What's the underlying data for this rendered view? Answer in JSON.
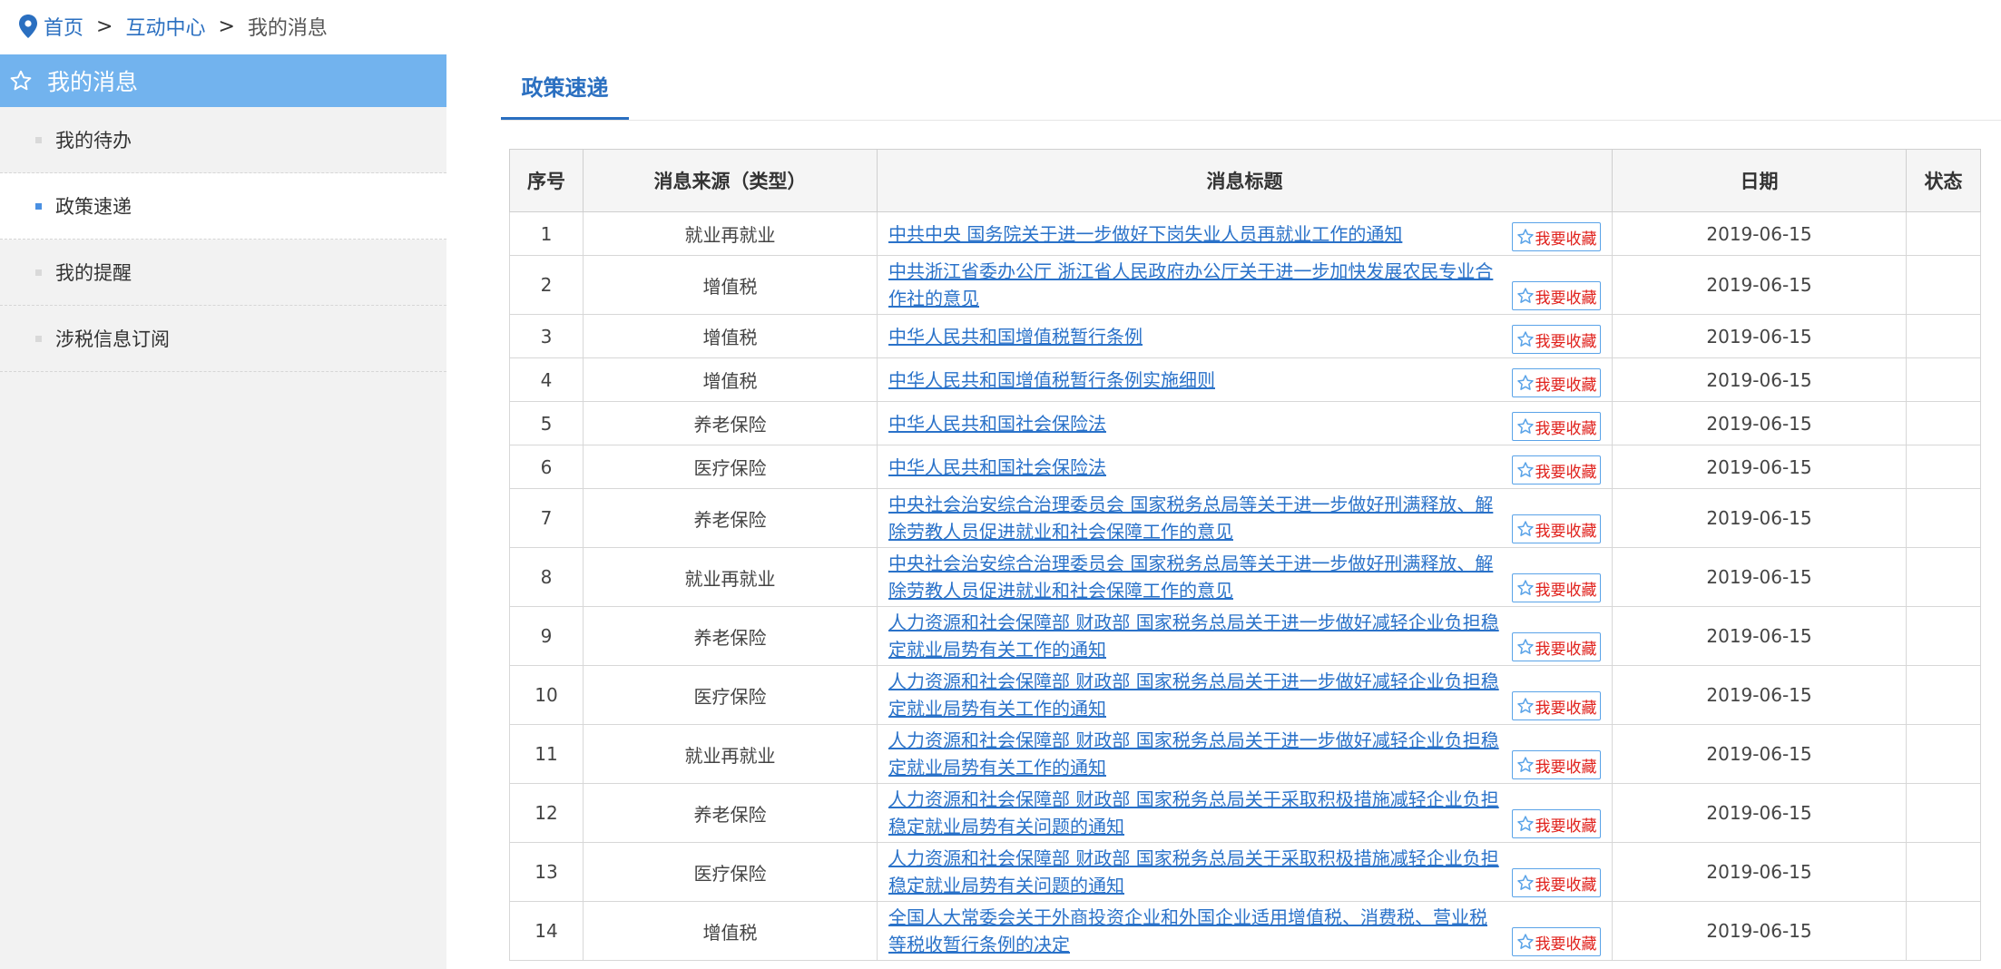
{
  "breadcrumb": {
    "home": "首页",
    "sep1": ">",
    "center": "互动中心",
    "sep2": ">",
    "current": "我的消息"
  },
  "sidebar": {
    "title": "我的消息",
    "items": [
      {
        "label": "我的待办",
        "active": false
      },
      {
        "label": "政策速递",
        "active": true
      },
      {
        "label": "我的提醒",
        "active": false
      },
      {
        "label": "涉税信息订阅",
        "active": false
      }
    ]
  },
  "tab": {
    "label": "政策速递"
  },
  "table": {
    "headers": {
      "index": "序号",
      "source": "消息来源（类型）",
      "title": "消息标题",
      "date": "日期",
      "status": "状态"
    },
    "favorite_label": "我要收藏",
    "rows": [
      {
        "index": "1",
        "source": "就业再就业",
        "title": "中共中央 国务院关于进一步做好下岗失业人员再就业工作的通知",
        "date": "2019-06-15",
        "status": ""
      },
      {
        "index": "2",
        "source": "增值税",
        "title": "中共浙江省委办公厅 浙江省人民政府办公厅关于进一步加快发展农民专业合作社的意见",
        "date": "2019-06-15",
        "status": ""
      },
      {
        "index": "3",
        "source": "增值税",
        "title": "中华人民共和国增值税暂行条例",
        "date": "2019-06-15",
        "status": ""
      },
      {
        "index": "4",
        "source": "增值税",
        "title": "中华人民共和国增值税暂行条例实施细则",
        "date": "2019-06-15",
        "status": ""
      },
      {
        "index": "5",
        "source": "养老保险",
        "title": "中华人民共和国社会保险法",
        "date": "2019-06-15",
        "status": ""
      },
      {
        "index": "6",
        "source": "医疗保险",
        "title": "中华人民共和国社会保险法",
        "date": "2019-06-15",
        "status": ""
      },
      {
        "index": "7",
        "source": "养老保险",
        "title": "中央社会治安综合治理委员会 国家税务总局等关于进一步做好刑满释放、解除劳教人员促进就业和社会保障工作的意见",
        "date": "2019-06-15",
        "status": ""
      },
      {
        "index": "8",
        "source": "就业再就业",
        "title": "中央社会治安综合治理委员会 国家税务总局等关于进一步做好刑满释放、解除劳教人员促进就业和社会保障工作的意见",
        "date": "2019-06-15",
        "status": "",
        "hover": true
      },
      {
        "index": "9",
        "source": "养老保险",
        "title": "人力资源和社会保障部 财政部 国家税务总局关于进一步做好减轻企业负担稳定就业局势有关工作的通知",
        "date": "2019-06-15",
        "status": ""
      },
      {
        "index": "10",
        "source": "医疗保险",
        "title": "人力资源和社会保障部 财政部 国家税务总局关于进一步做好减轻企业负担稳定就业局势有关工作的通知",
        "date": "2019-06-15",
        "status": ""
      },
      {
        "index": "11",
        "source": "就业再就业",
        "title": "人力资源和社会保障部 财政部 国家税务总局关于进一步做好减轻企业负担稳定就业局势有关工作的通知",
        "date": "2019-06-15",
        "status": ""
      },
      {
        "index": "12",
        "source": "养老保险",
        "title": "人力资源和社会保障部 财政部 国家税务总局关于采取积极措施减轻企业负担稳定就业局势有关问题的通知",
        "date": "2019-06-15",
        "status": ""
      },
      {
        "index": "13",
        "source": "医疗保险",
        "title": "人力资源和社会保障部 财政部 国家税务总局关于采取积极措施减轻企业负担稳定就业局势有关问题的通知",
        "date": "2019-06-15",
        "status": ""
      },
      {
        "index": "14",
        "source": "增值税",
        "title": "全国人大常委会关于外商投资企业和外国企业适用增值税、消费税、营业税等税收暂行条例的决定",
        "date": "2019-06-15",
        "status": ""
      }
    ]
  },
  "colors": {
    "accent": "#2a6fc0",
    "sidebar_header": "#72b3ee",
    "favorite_text": "#e0201b"
  },
  "icons": {
    "breadcrumb": "location-pin-icon",
    "sidebar_header": "star-outline-icon",
    "favorite": "star-outline-icon"
  }
}
